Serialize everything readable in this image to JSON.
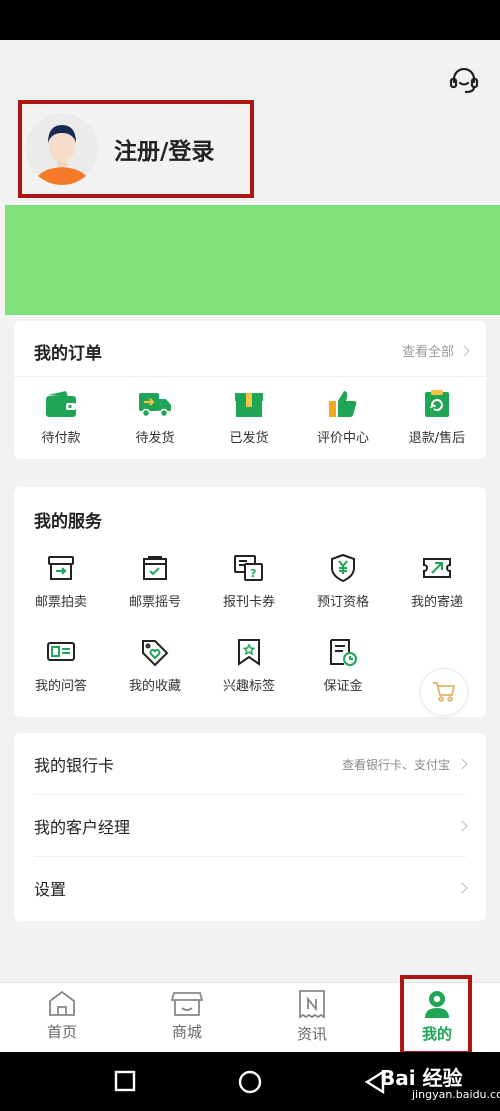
{
  "header": {
    "login_label": "注册/登录",
    "customer_service_icon": "headset-icon"
  },
  "orders": {
    "title": "我的订单",
    "view_all": "查看全部",
    "items": [
      {
        "label": "待付款",
        "icon": "wallet-icon"
      },
      {
        "label": "待发货",
        "icon": "truck-icon"
      },
      {
        "label": "已发货",
        "icon": "package-icon"
      },
      {
        "label": "评价中心",
        "icon": "thumbs-up-icon"
      },
      {
        "label": "退款/售后",
        "icon": "refund-icon"
      }
    ]
  },
  "services": {
    "title": "我的服务",
    "items": [
      {
        "label": "邮票拍卖",
        "icon": "auction-box-icon"
      },
      {
        "label": "邮票摇号",
        "icon": "lottery-box-icon"
      },
      {
        "label": "报刊卡券",
        "icon": "coupon-icon"
      },
      {
        "label": "预订资格",
        "icon": "shield-yen-icon"
      },
      {
        "label": "我的寄递",
        "icon": "delivery-icon"
      },
      {
        "label": "我的问答",
        "icon": "qa-card-icon"
      },
      {
        "label": "我的收藏",
        "icon": "heart-tag-icon"
      },
      {
        "label": "兴趣标签",
        "icon": "bookmark-star-icon"
      },
      {
        "label": "保证金",
        "icon": "deposit-doc-icon"
      }
    ]
  },
  "list": {
    "bank_card": "我的银行卡",
    "bank_card_hint": "查看银行卡、支付宝",
    "manager": "我的客户经理",
    "settings": "设置"
  },
  "tabs": [
    {
      "label": "首页",
      "icon": "home-icon"
    },
    {
      "label": "商城",
      "icon": "shop-icon"
    },
    {
      "label": "资讯",
      "icon": "news-icon"
    },
    {
      "label": "我的",
      "icon": "user-icon",
      "active": true
    }
  ],
  "watermark": {
    "main": "Bai 经验",
    "sub": "jingyan.baidu.com"
  },
  "colors": {
    "accent": "#1ea555",
    "banner": "#80e27c",
    "highlight": "#b01515"
  }
}
